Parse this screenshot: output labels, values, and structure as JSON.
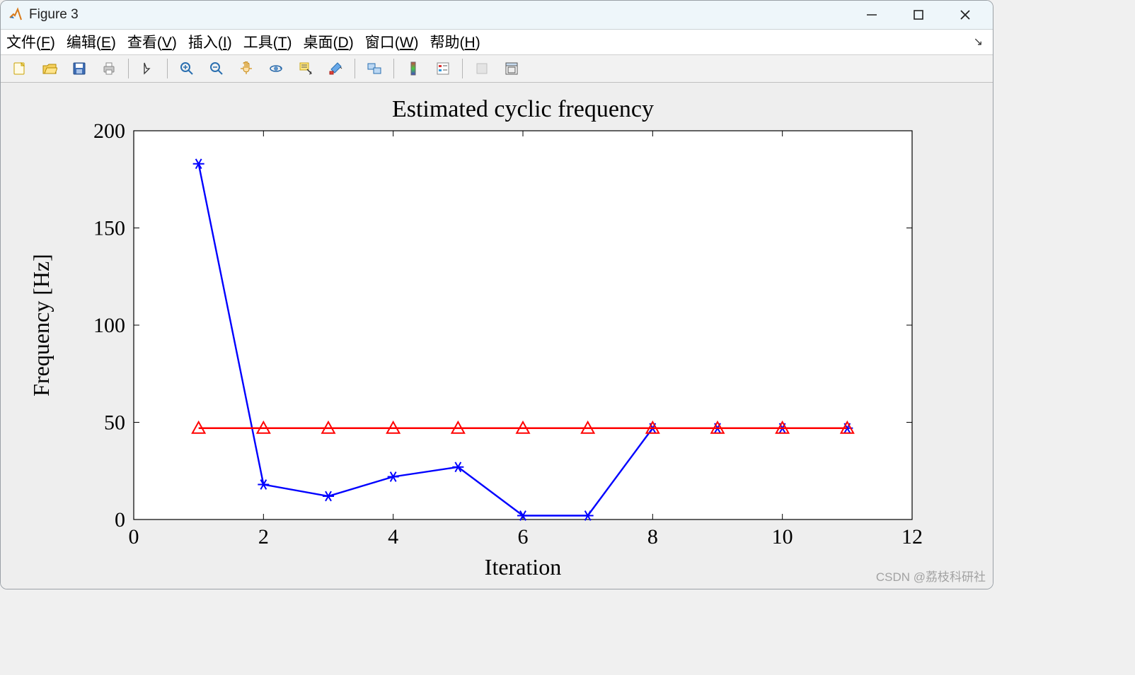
{
  "window": {
    "title": "Figure 3"
  },
  "menu": {
    "file": "文件(F)",
    "edit": "编辑(E)",
    "view": "查看(V)",
    "insert": "插入(I)",
    "tools": "工具(T)",
    "desktop": "桌面(D)",
    "window_menu": "窗口(W)",
    "help": "帮助(H)"
  },
  "watermark": "CSDN @荔枝科研社",
  "chart_data": {
    "type": "line",
    "title": "Estimated cyclic frequency",
    "xlabel": "Iteration",
    "ylabel": "Frequency [Hz]",
    "xlim": [
      0,
      12
    ],
    "ylim": [
      0,
      200
    ],
    "xticks": [
      0,
      2,
      4,
      6,
      8,
      10,
      12
    ],
    "yticks": [
      0,
      50,
      100,
      150,
      200
    ],
    "x": [
      1,
      2,
      3,
      4,
      5,
      6,
      7,
      8,
      9,
      10,
      11
    ],
    "series": [
      {
        "name": "series-blue-star",
        "color": "#0000ff",
        "marker": "star",
        "values": [
          183,
          18,
          12,
          22,
          27,
          2,
          2,
          47,
          47,
          47,
          47
        ]
      },
      {
        "name": "series-red-triangle",
        "color": "#ff0000",
        "marker": "triangle",
        "values": [
          47,
          47,
          47,
          47,
          47,
          47,
          47,
          47,
          47,
          47,
          47
        ]
      }
    ]
  }
}
